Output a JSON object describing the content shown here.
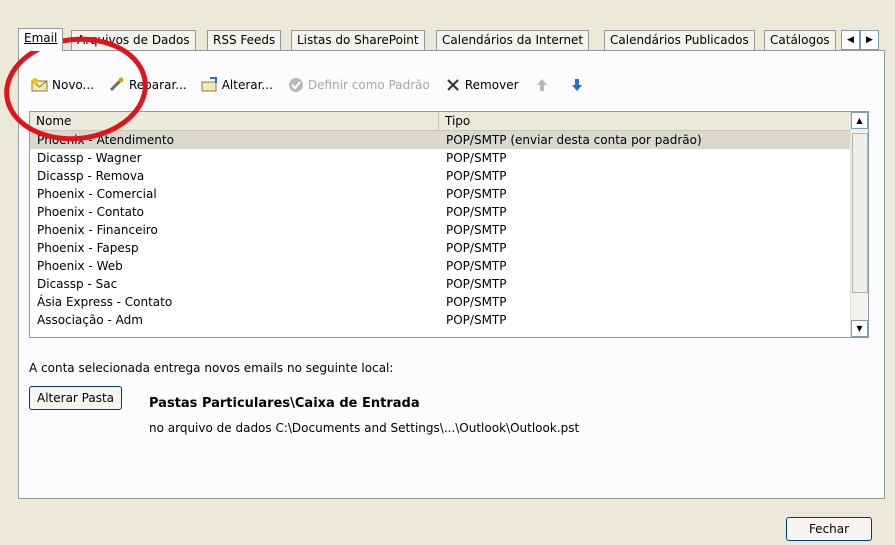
{
  "tabs": [
    {
      "label": "Email",
      "active": true
    },
    {
      "label": "Arquivos de Dados",
      "active": false
    },
    {
      "label": "RSS Feeds",
      "active": false
    },
    {
      "label": "Listas do SharePoint",
      "active": false
    },
    {
      "label": "Calendários da Internet",
      "active": false
    },
    {
      "label": "Calendários Publicados",
      "active": false
    },
    {
      "label": "Catálogos",
      "active": false
    }
  ],
  "toolbar": {
    "new_label": "Novo...",
    "repair_label": "Reparar...",
    "change_label": "Alterar...",
    "default_label": "Definir como Padrão",
    "remove_label": "Remover"
  },
  "list": {
    "col_name": "Nome",
    "col_type": "Tipo",
    "rows": [
      {
        "name": "Phoenix - Atendimento",
        "type": "POP/SMTP (enviar desta conta por padrão)"
      },
      {
        "name": "Dicassp - Wagner",
        "type": "POP/SMTP"
      },
      {
        "name": "Dicassp - Remova",
        "type": "POP/SMTP"
      },
      {
        "name": "Phoenix - Comercial",
        "type": "POP/SMTP"
      },
      {
        "name": "Phoenix - Contato",
        "type": "POP/SMTP"
      },
      {
        "name": "Phoenix - Financeiro",
        "type": "POP/SMTP"
      },
      {
        "name": "Phoenix - Fapesp",
        "type": "POP/SMTP"
      },
      {
        "name": "Phoenix - Web",
        "type": "POP/SMTP"
      },
      {
        "name": "Dicassp - Sac",
        "type": "POP/SMTP"
      },
      {
        "name": "Ásia Express - Contato",
        "type": "POP/SMTP"
      },
      {
        "name": "Associação - Adm",
        "type": "POP/SMTP"
      }
    ]
  },
  "delivery": {
    "info_text": "A conta selecionada entrega novos emails no seguinte local:",
    "change_folder_label": "Alterar Pasta",
    "folder_title": "Pastas Particulares\\Caixa de Entrada",
    "folder_path": "no arquivo de dados C:\\Documents and Settings\\...\\Outlook\\Outlook.pst"
  },
  "close_label": "Fechar",
  "colors": {
    "annotation": "#e0141b",
    "selection": "#dad9d0"
  }
}
